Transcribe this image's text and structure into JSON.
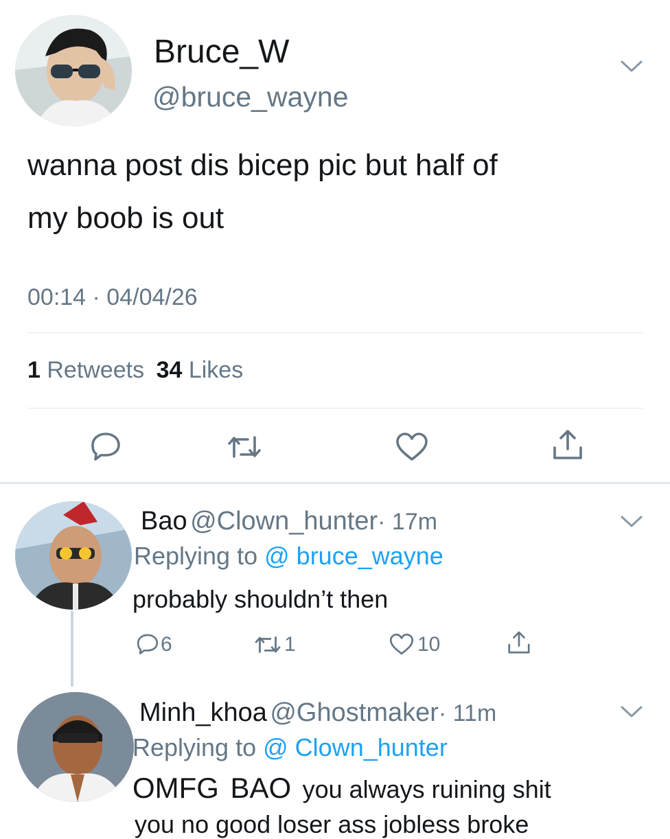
{
  "tweet": {
    "display_name": "Bruce_W",
    "handle": "@bruce_wayne",
    "text_line1": "wanna post dis bicep pic but half of",
    "text_line2": "my boob is out",
    "timestamp": "00:14 · 04/04/26",
    "retweets_count": "1",
    "retweets_label": "Retweets",
    "likes_count": "34",
    "likes_label": "Likes"
  },
  "replies": [
    {
      "display_name": "Bao",
      "handle": "@Clown_hunter",
      "time": "· 17m",
      "replying_label": "Replying to",
      "replying_to": "@ bruce_wayne",
      "text": "probably shouldn’t then",
      "reply_count": "6",
      "retweet_count": "1",
      "like_count": "10"
    },
    {
      "display_name": "Minh_khoa",
      "handle": "@Ghostmaker",
      "time": "· 11m",
      "replying_label": "Replying to",
      "replying_to": "@ Clown_hunter",
      "text_part1": "OMFG",
      "text_part2": "BAO",
      "text_part3": "you always ruining shit",
      "text_line2": "you no good loser ass jobless broke"
    }
  ],
  "icons": {
    "menu": "chevron-down-icon",
    "reply": "speech-bubble-icon",
    "retweet": "retweet-arrows-icon",
    "like": "heart-icon",
    "share": "share-upload-icon"
  },
  "colors": {
    "text": "#14171a",
    "secondary": "#657786",
    "link": "#1da1f2",
    "divider": "#e1e8ed"
  }
}
